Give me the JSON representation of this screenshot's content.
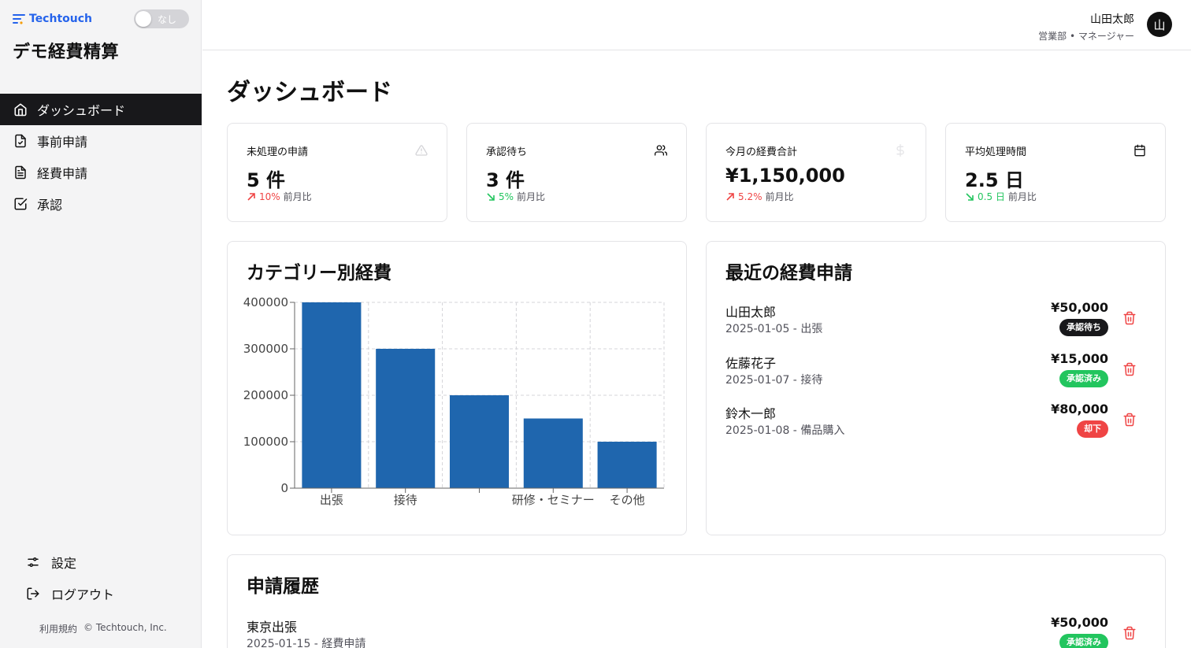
{
  "brand": {
    "name": "Techtouch",
    "toggle_label": "なし"
  },
  "app_title": "デモ経費精算",
  "nav": [
    {
      "label": "ダッシュボード",
      "icon": "home-icon",
      "active": true
    },
    {
      "label": "事前申請",
      "icon": "file-check-icon"
    },
    {
      "label": "経費申請",
      "icon": "file-text-icon"
    },
    {
      "label": "承認",
      "icon": "square-check-icon"
    }
  ],
  "bottom_nav": [
    {
      "label": "設定",
      "icon": "sliders-icon"
    },
    {
      "label": "ログアウト",
      "icon": "logout-icon"
    }
  ],
  "footer": {
    "terms": "利用規約",
    "copyright": "© Techtouch, Inc."
  },
  "user": {
    "name": "山田太郎",
    "role": "営業部 • マネージャー",
    "avatar": "山"
  },
  "page_title": "ダッシュボード",
  "stats": [
    {
      "title": "未処理の申請",
      "value": "5 件",
      "change": "10%",
      "direction": "up",
      "suffix": "前月比",
      "icon": "alert-triangle-icon"
    },
    {
      "title": "承認待ち",
      "value": "3 件",
      "change": "5%",
      "direction": "down",
      "suffix": "前月比",
      "icon": "users-icon"
    },
    {
      "title": "今月の経費合計",
      "value": "¥1,150,000",
      "change": "5.2%",
      "direction": "up",
      "suffix": "前月比",
      "icon": "dollar-icon"
    },
    {
      "title": "平均処理時間",
      "value": "2.5 日",
      "change": "0.5 日",
      "direction": "down",
      "suffix": "前月比",
      "icon": "calendar-icon"
    }
  ],
  "colors": {
    "up": "#ef4444",
    "down": "#22c55e",
    "bar": "#1f66ae",
    "pending": "#18181b",
    "approved": "#22c55e",
    "rejected": "#ef4444"
  },
  "category_chart": {
    "title": "カテゴリー別経費"
  },
  "chart_data": {
    "type": "bar",
    "title": "カテゴリー別経費",
    "categories": [
      "出張",
      "接待",
      "",
      "研修・セミナー",
      "その他"
    ],
    "values": [
      400000,
      300000,
      200000,
      150000,
      100000
    ],
    "ylim": [
      0,
      400000
    ],
    "yticks": [
      0,
      100000,
      200000,
      300000,
      400000
    ],
    "grid": true,
    "xlabel": "",
    "ylabel": ""
  },
  "recent": {
    "title": "最近の経費申請",
    "items": [
      {
        "name": "山田太郎",
        "sub": "2025-01-05 - 出張",
        "amount": "¥50,000",
        "status": "承認待ち",
        "status_type": "pending"
      },
      {
        "name": "佐藤花子",
        "sub": "2025-01-07 - 接待",
        "amount": "¥15,000",
        "status": "承認済み",
        "status_type": "approved"
      },
      {
        "name": "鈴木一郎",
        "sub": "2025-01-08 - 備品購入",
        "amount": "¥80,000",
        "status": "却下",
        "status_type": "rejected"
      }
    ]
  },
  "history": {
    "title": "申請履歴",
    "items": [
      {
        "name": "東京出張",
        "sub": "2025-01-15 - 経費申請",
        "amount": "¥50,000",
        "status": "承認済み",
        "status_type": "approved"
      }
    ]
  }
}
